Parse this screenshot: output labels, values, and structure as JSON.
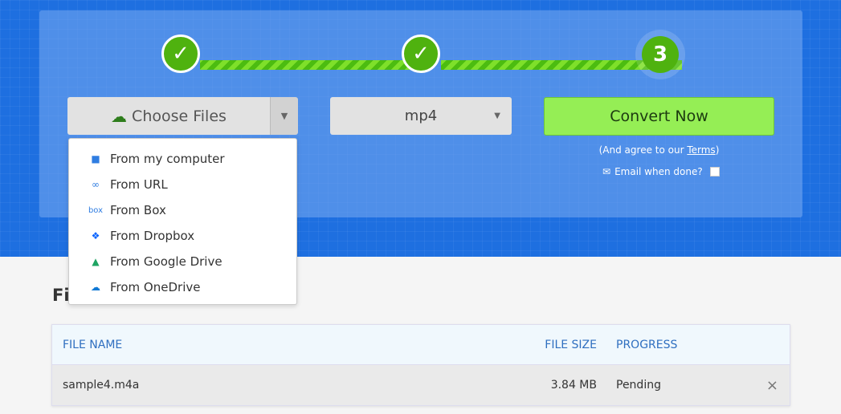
{
  "steps": [
    {
      "label": "✓",
      "state": "done"
    },
    {
      "label": "✓",
      "state": "done"
    },
    {
      "label": "3",
      "state": "active"
    }
  ],
  "colors": {
    "hero": "#1e6fe0",
    "accent": "#95ee55",
    "step": "#4fb20f"
  },
  "choose_files": {
    "label": "Choose Files",
    "icon": "cloud-upload-icon",
    "caret": "▼"
  },
  "menu": [
    {
      "label": "From my computer",
      "icon": "folder-icon"
    },
    {
      "label": "From URL",
      "icon": "link-icon"
    },
    {
      "label": "From Box",
      "icon": "box-icon"
    },
    {
      "label": "From Dropbox",
      "icon": "dropbox-icon"
    },
    {
      "label": "From Google Drive",
      "icon": "google-drive-icon"
    },
    {
      "label": "From OneDrive",
      "icon": "onedrive-icon"
    }
  ],
  "format": {
    "value": "mp4",
    "arrow": "▼"
  },
  "convert": {
    "label": "Convert Now",
    "agree_prefix": "(And agree to our ",
    "terms": "Terms",
    "agree_suffix": ")",
    "email_label": "Email when done?"
  },
  "files": {
    "heading": "Files",
    "headers": [
      "FILE NAME",
      "FILE SIZE",
      "PROGRESS"
    ],
    "rows": [
      {
        "name": "sample4.m4a",
        "size": "3.84 MB",
        "progress": "Pending",
        "remove": "×"
      }
    ]
  }
}
